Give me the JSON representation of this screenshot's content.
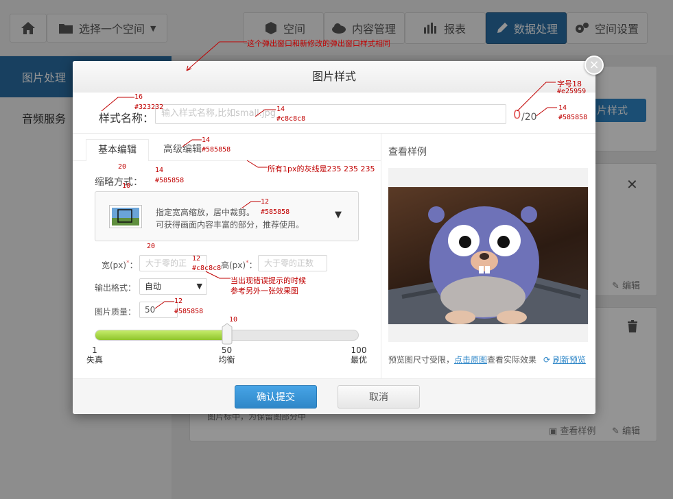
{
  "background": {
    "nav": {
      "space_select": "选择一个空间",
      "space": "空间",
      "content_mgmt": "内容管理",
      "reports": "报表",
      "data_processing": "数据处理",
      "space_settings": "空间设置"
    },
    "sidebar": [
      {
        "label": "图片处理"
      },
      {
        "label": "音频服务"
      }
    ],
    "new_style_button": "片样式",
    "edit_label": "编辑",
    "view_sample_label": "查看样例",
    "partial_text": "图片标中，为保留图部分中"
  },
  "modal": {
    "title": "图片样式",
    "close_glyph": "×",
    "style_name_label": "样式名称：",
    "style_name_placeholder": "输入样式名称,比如small.jpg",
    "char_count": "0",
    "char_max": "/20",
    "tabs": [
      {
        "label": "基本编辑"
      },
      {
        "label": "高级编辑"
      }
    ],
    "preview_header": "查看样例",
    "scale_label": "缩略方式：",
    "scale_option_line1": "指定宽高缩放，居中裁剪。",
    "scale_option_line2": "可获得画面内容丰富的部分，推荐使用。",
    "width_label": "宽(px)",
    "height_label": "高(px)",
    "required_mark": "*",
    "colon": "：",
    "width_placeholder": "大于零的正",
    "height_placeholder": "大于零的正数",
    "output_label": "输出格式：",
    "output_value": "自动",
    "quality_label": "图片质量：",
    "quality_value": "50",
    "slider": {
      "value": 50,
      "min": 0,
      "max": 100,
      "ticks": [
        {
          "num": "1",
          "label": "失真"
        },
        {
          "num": "50",
          "label": "均衡"
        },
        {
          "num": "100",
          "label": "最优"
        }
      ]
    },
    "preview_note": "预览图尺寸受限，",
    "preview_link": "点击原图",
    "preview_note2": "查看实际效果",
    "refresh_label": "刷新预览",
    "confirm_button": "确认提交",
    "cancel_button": "取消"
  },
  "annotations": {
    "a1": "这个弹出窗口和新修改的弹出窗口样式相同",
    "a2": "16",
    "a3": "#323232",
    "a4": "14",
    "a5": "#c8c8c8",
    "a6": "字号18",
    "a7": "#e25959",
    "a8": "14",
    "a9": "#585858",
    "a10": "14",
    "a11": "#585858",
    "a12": "所有1px的灰线是235 235 235",
    "a13": "20",
    "a14": "14",
    "a15": "#585858",
    "a16": "10",
    "a17": "12",
    "a18": "#585858",
    "a19": "20",
    "a20": "12",
    "a21": "#c8c8c8",
    "a22": "当出现错误提示的时候",
    "a23": "参考另外一张效果图",
    "a24": "12",
    "a25": "#585858",
    "a26": "10"
  },
  "colors": {
    "accent_blue": "#2f87c8",
    "counter_red": "#e25959",
    "slider_green": "#9bd12f",
    "line_gray": "#ebebeb"
  }
}
